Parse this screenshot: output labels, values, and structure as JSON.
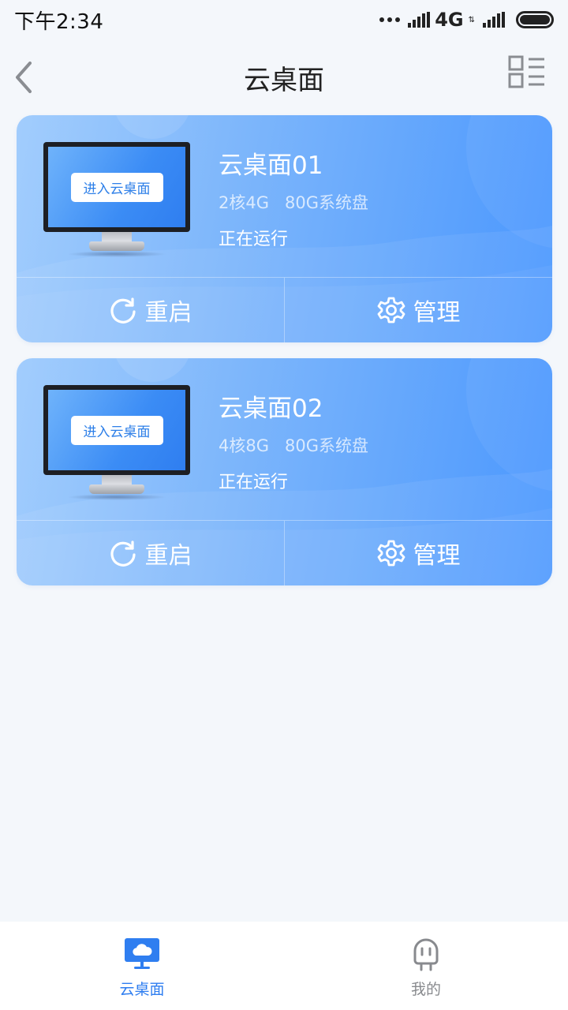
{
  "status_bar": {
    "time": "下午2:34",
    "network": "4G",
    "network_arrows": "⇅"
  },
  "header": {
    "title": "云桌面",
    "back_icon": "chevron-left-icon",
    "layout_icon": "list-layout-icon"
  },
  "cards": [
    {
      "name": "云桌面01",
      "cpu": "2核4G",
      "disk": "80G系统盘",
      "status": "正在运行",
      "enter_label": "进入云桌面",
      "restart_label": "重启",
      "manage_label": "管理"
    },
    {
      "name": "云桌面02",
      "cpu": "4核8G",
      "disk": "80G系统盘",
      "status": "正在运行",
      "enter_label": "进入云桌面",
      "restart_label": "重启",
      "manage_label": "管理"
    }
  ],
  "tab_bar": {
    "tabs": [
      {
        "label": "云桌面",
        "icon": "cloud-monitor-icon",
        "active": true
      },
      {
        "label": "我的",
        "icon": "robot-face-icon",
        "active": false
      }
    ]
  },
  "colors": {
    "accent": "#2f7ef0",
    "card_gradient_start": "#a2cdfd",
    "card_gradient_end": "#4a97fe",
    "background": "#f4f7fb",
    "inactive": "#888a8e"
  }
}
